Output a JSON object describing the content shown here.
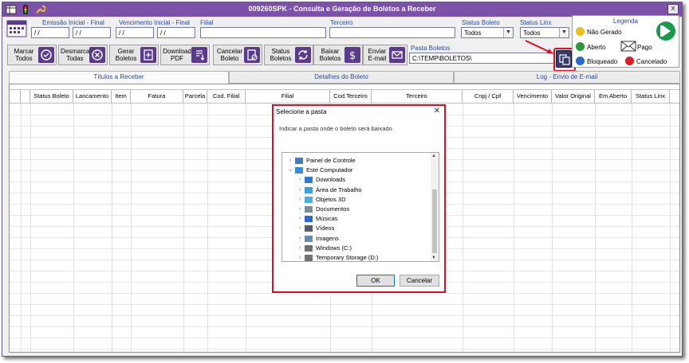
{
  "window": {
    "title": "009260SPK - Consulta e Geração de Boletos a Receber",
    "close": "x"
  },
  "filters": {
    "emissao_label": "Emissão Inicial - Final",
    "emissao_ini": "/ /",
    "emissao_fim": "/ /",
    "vencimento_label": "Vencimento Inicial - Final",
    "vencimento_ini": "/ /",
    "vencimento_fim": "/ /",
    "filial_label": "Filial",
    "filial_value": "",
    "terceiro_label": "Terceiro",
    "terceiro_value": "",
    "status_boleto_label": "Status Boleto",
    "status_boleto_value": "Todos",
    "status_linx_label": "Status Linx",
    "status_linx_value": "Todos",
    "pasta_label": "Pasta Boletos",
    "pasta_value": "C:\\TEMP\\BOLETOS\\"
  },
  "toolbar": {
    "marcar": "Marcar Todos",
    "desmarcar": "Desmarcar Todas",
    "gerar": "Gerar Boletos",
    "download": "Download PDF",
    "cancelar": "Cancelar Boleto",
    "status": "Status Boletos",
    "baixar": "Baixar Boletos",
    "enviar": "Enviar E-mail"
  },
  "legend": {
    "title": "Legenda",
    "nao_gerado": "Não Gerado",
    "aberto": "Aberto",
    "pago": "Pago",
    "bloqueado": "Bloqueado",
    "cancelado": "Cancelado",
    "colors": {
      "nao_gerado": "#e8c020",
      "aberto": "#2a9a3a",
      "bloqueado": "#2a6acc",
      "cancelado": "#d8202a"
    }
  },
  "tabs": [
    "Títulos a Receber",
    "Detalhes do Boleto",
    "Log - Envio de E-mail"
  ],
  "grid": {
    "columns": [
      "Status Boleto",
      "Lancamento",
      "Item",
      "Fatura",
      "Parcela",
      "Cod. Filial",
      "Filial",
      "Cod.Terceiro",
      "Terceiro",
      "Cnpj / Cpf",
      "Vencimento",
      "Valor Original",
      "Em Aberto",
      "Status Linx"
    ]
  },
  "dialog": {
    "title": "Selecione a pasta",
    "close": "✕",
    "message": "Indicar a pasta onde o boleto será baixado",
    "tree": [
      {
        "label": "Painel de Controle",
        "icon": "control-panel-icon",
        "expand": ">"
      },
      {
        "label": "Este Computador",
        "icon": "computer-icon",
        "expand": "v"
      },
      {
        "label": "Downloads",
        "icon": "download-folder-icon",
        "expand": ">"
      },
      {
        "label": "Área de Trabalho",
        "icon": "desktop-folder-icon",
        "expand": ">"
      },
      {
        "label": "Objetos 3D",
        "icon": "3d-objects-icon",
        "expand": ">"
      },
      {
        "label": "Documentos",
        "icon": "documents-icon",
        "expand": ">"
      },
      {
        "label": "Músicas",
        "icon": "music-icon",
        "expand": ">"
      },
      {
        "label": "Vídeos",
        "icon": "video-icon",
        "expand": ">"
      },
      {
        "label": "Imagens",
        "icon": "pictures-icon",
        "expand": ">"
      },
      {
        "label": "Windows (C:)",
        "icon": "drive-icon",
        "expand": ">"
      },
      {
        "label": "Temporary Storage (D:)",
        "icon": "drive-icon",
        "expand": ">"
      }
    ],
    "ok": "OK",
    "cancel": "Cancelar"
  },
  "colors": {
    "title_bar": "#7b52a8",
    "button_icon": "#5a3a8a",
    "highlight": "#d0142c"
  }
}
